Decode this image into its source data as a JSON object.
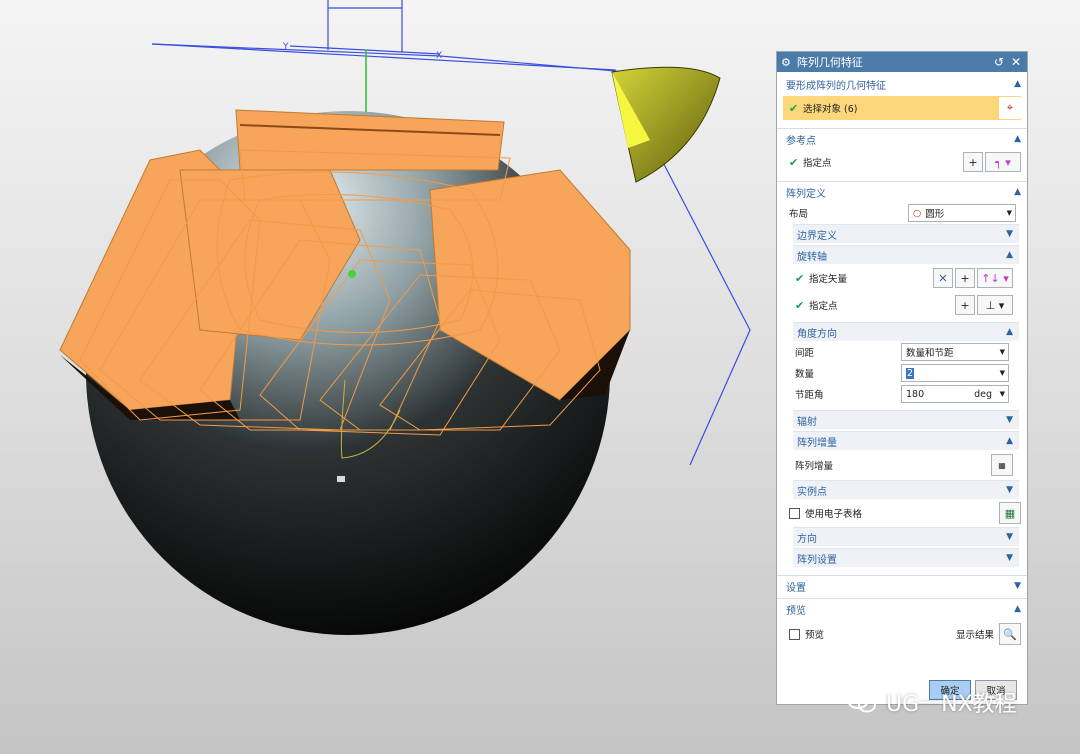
{
  "viewport": {
    "axis_y": "Y",
    "axis_x": "X"
  },
  "dialog": {
    "title": "阵列几何特征",
    "sections": {
      "geometry": {
        "header": "要形成阵列的几何特征",
        "select_label": "选择对象 (6)"
      },
      "reference": {
        "header": "参考点",
        "point_label": "指定点"
      },
      "pattern": {
        "header": "阵列定义",
        "layout_label": "布局",
        "layout_value": "圆形",
        "boundary_header": "边界定义",
        "axis_header": "旋转轴",
        "vector_label": "指定矢量",
        "axis_point_label": "指定点",
        "angle_header": "角度方向",
        "spacing_label": "间距",
        "spacing_value": "数量和节距",
        "count_label": "数量",
        "count_value": "2",
        "pitch_label": "节距角",
        "pitch_value": "180",
        "pitch_unit": "deg",
        "radial_header": "辐射",
        "increment_header": "阵列增量",
        "increment_label": "阵列增量",
        "instance_header": "实例点",
        "spreadsheet_label": "使用电子表格",
        "orientation_header": "方向",
        "settings_sub_header": "阵列设置"
      },
      "settings": {
        "header": "设置"
      },
      "preview": {
        "header": "预览",
        "preview_label": "预览",
        "show_result_label": "显示结果"
      }
    },
    "ok_label": "确定",
    "cancel_label": "取消"
  },
  "watermark": "UG一NX教程",
  "colors": {
    "title_bar": "#4b7ca9",
    "accent": "#2f62a0",
    "selection": "#fbd77a",
    "part_orange": "#f6a55a"
  }
}
